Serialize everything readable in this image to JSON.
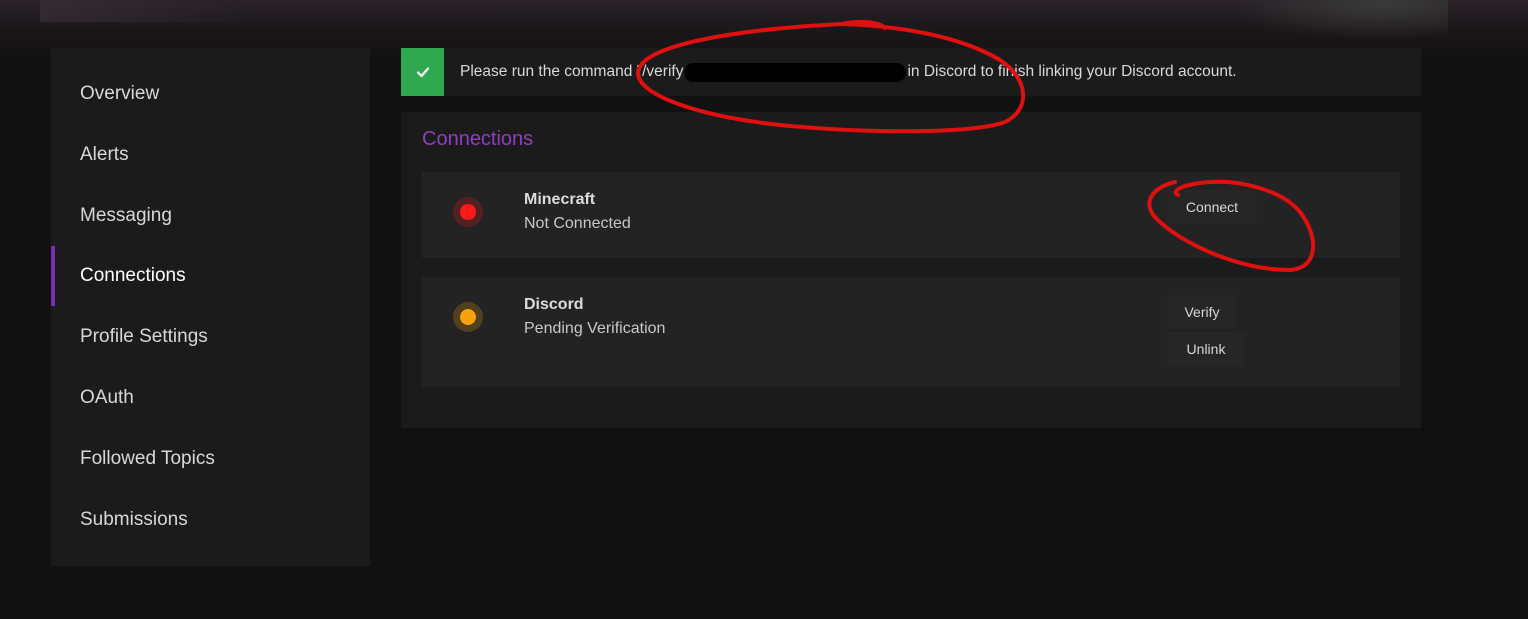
{
  "alert": {
    "text_before": "Please run the command \"/verify",
    "text_after": "in Discord to finish linking your Discord account."
  },
  "sidebar": {
    "items": [
      {
        "label": "Overview",
        "active": false
      },
      {
        "label": "Alerts",
        "active": false
      },
      {
        "label": "Messaging",
        "active": false
      },
      {
        "label": "Connections",
        "active": true
      },
      {
        "label": "Profile Settings",
        "active": false
      },
      {
        "label": "OAuth",
        "active": false
      },
      {
        "label": "Followed Topics",
        "active": false
      },
      {
        "label": "Submissions",
        "active": false
      }
    ]
  },
  "connections": {
    "title": "Connections",
    "items": [
      {
        "name": "Minecraft",
        "status": "Not Connected",
        "status_color": "#ff1a1a",
        "buttons": [
          "Connect"
        ]
      },
      {
        "name": "Discord",
        "status": "Pending Verification",
        "status_color": "#f5a30a",
        "buttons": [
          "Verify",
          "Unlink"
        ]
      }
    ]
  },
  "colors": {
    "accent": "#8e3fc0",
    "alert_success": "#2fa84f",
    "annotation": "#e01010"
  }
}
